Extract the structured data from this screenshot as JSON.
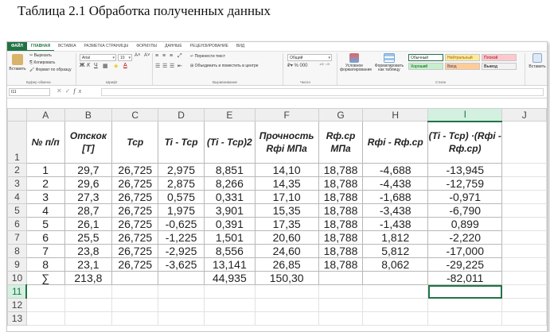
{
  "caption": "Таблица 2.1 Обработка полученных данных",
  "ribbon": {
    "tabs": [
      "ФАЙЛ",
      "ГЛАВНАЯ",
      "ВСТАВКА",
      "РАЗМЕТКА СТРАНИЦЫ",
      "ФОРМУЛЫ",
      "ДАННЫЕ",
      "РЕЦЕНЗИРОВАНИЕ",
      "ВИД"
    ],
    "paste": "Вставить",
    "cut": "Вырезать",
    "copy": "Копировать",
    "format_painter": "Формат по образцу",
    "clipboard_group": "Буфер обмена",
    "font_name": "Arial",
    "font_size": "10",
    "font_group": "Шрифт",
    "wrap_text": "Перенести текст",
    "merge_center": "Объединить и поместить в центре",
    "align_group": "Выравнивание",
    "number_format": "Общий",
    "number_group": "Число",
    "cond_format": "Условное форматирование",
    "format_table": "Форматировать как таблицу",
    "styles_group": "Стили",
    "styles": {
      "normal": "Обычный",
      "neutral": "Нейтральный",
      "bad": "Плохой",
      "good": "Хороший",
      "input": "Ввод",
      "output": "Вывод"
    },
    "insert": "Вставить"
  },
  "formula_bar": {
    "name_box": "I11",
    "fx": "fx",
    "value": ""
  },
  "grid": {
    "columns": [
      "A",
      "B",
      "C",
      "D",
      "E",
      "F",
      "G",
      "H",
      "I",
      "J"
    ],
    "headers": [
      "№ п/п",
      "Отскок [T]",
      "Tcp",
      "Ti - Tcp",
      "(Ti - Tcp)2",
      "Прочность Rфi МПа",
      "Rф.ср МПа",
      "Rфi - Rф.ср",
      "(Ti - Tcp) ·(Rфi - Rф.ср)"
    ],
    "rows": [
      [
        "1",
        "29,7",
        "26,725",
        "2,975",
        "8,851",
        "14,10",
        "18,788",
        "-4,688",
        "-13,945"
      ],
      [
        "2",
        "29,6",
        "26,725",
        "2,875",
        "8,266",
        "14,35",
        "18,788",
        "-4,438",
        "-12,759"
      ],
      [
        "3",
        "27,3",
        "26,725",
        "0,575",
        "0,331",
        "17,10",
        "18,788",
        "-1,688",
        "-0,971"
      ],
      [
        "4",
        "28,7",
        "26,725",
        "1,975",
        "3,901",
        "15,35",
        "18,788",
        "-3,438",
        "-6,790"
      ],
      [
        "5",
        "26,1",
        "26,725",
        "-0,625",
        "0,391",
        "17,35",
        "18,788",
        "-1,438",
        "0,899"
      ],
      [
        "6",
        "25,5",
        "26,725",
        "-1,225",
        "1,501",
        "20,60",
        "18,788",
        "1,812",
        "-2,220"
      ],
      [
        "7",
        "23,8",
        "26,725",
        "-2,925",
        "8,556",
        "24,60",
        "18,788",
        "5,812",
        "-17,000"
      ],
      [
        "8",
        "23,1",
        "26,725",
        "-3,625",
        "13,141",
        "26,85",
        "18,788",
        "8,062",
        "-29,225"
      ],
      [
        "∑",
        "213,8",
        "",
        "",
        "44,935",
        "150,30",
        "",
        "",
        "-82,011"
      ]
    ],
    "row_numbers": [
      "1",
      "2",
      "3",
      "4",
      "5",
      "6",
      "7",
      "8",
      "9",
      "10",
      "11",
      "12",
      "13"
    ]
  },
  "colors": {
    "excel_green": "#217346",
    "style_good": "#c6efce",
    "style_neutral": "#ffeb9c",
    "style_bad": "#ffc7ce",
    "style_input": "#ffcc99",
    "style_output": "#f2f2f2"
  }
}
